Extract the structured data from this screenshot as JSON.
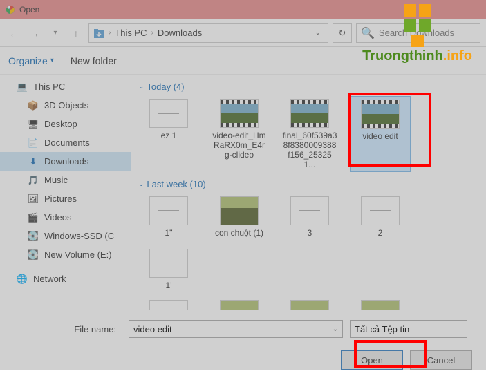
{
  "title": "Open",
  "breadcrumbs": {
    "root": "This PC",
    "folder": "Downloads"
  },
  "search_placeholder": "Search Downloads",
  "toolbar": {
    "organize": "Organize",
    "newfolder": "New folder"
  },
  "sidebar": {
    "thispc": "This PC",
    "items": [
      {
        "label": "3D Objects"
      },
      {
        "label": "Desktop"
      },
      {
        "label": "Documents"
      },
      {
        "label": "Downloads"
      },
      {
        "label": "Music"
      },
      {
        "label": "Pictures"
      },
      {
        "label": "Videos"
      },
      {
        "label": "Windows-SSD (C"
      },
      {
        "label": "New Volume (E:)"
      }
    ],
    "network": "Network"
  },
  "groups": {
    "today": {
      "label": "Today (4)"
    },
    "lastweek": {
      "label": "Last week (10)"
    }
  },
  "files_today": [
    {
      "name": "ez 1"
    },
    {
      "name": "video-edit_HmRaRX0m_E4rg-clideo"
    },
    {
      "name": "final_60f539a38f8380009388f156_253251..."
    },
    {
      "name": "video edit"
    }
  ],
  "files_lastweek": [
    {
      "name": "1''"
    },
    {
      "name": "con chuột (1)"
    },
    {
      "name": "3"
    },
    {
      "name": "2"
    },
    {
      "name": "1'"
    }
  ],
  "footer": {
    "filename_label": "File name:",
    "filename_value": "video edit",
    "filetype": "Tất cả Tệp tin",
    "open": "Open",
    "cancel": "Cancel"
  },
  "watermark": {
    "text1": "Truongthinh",
    "text2": ".info"
  }
}
